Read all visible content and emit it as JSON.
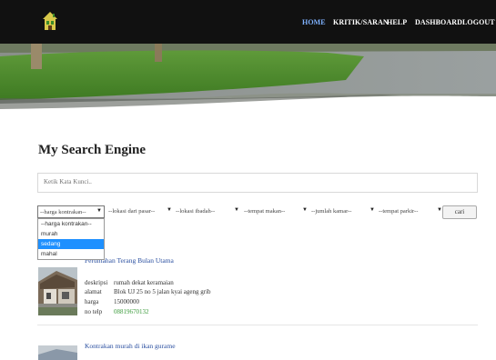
{
  "nav": {
    "items": [
      {
        "label": "HOME",
        "active": true
      },
      {
        "label": "KRITIK/SARAN",
        "active": false
      },
      {
        "label": "HELP",
        "active": false
      },
      {
        "label": "DASHBOARD",
        "active": false
      },
      {
        "label": "LOGOUT",
        "active": false
      }
    ]
  },
  "page": {
    "title": "My Search Engine",
    "search_placeholder": "Ketik Kata Kunci.."
  },
  "filters": [
    {
      "label": "--harga kontrakan--"
    },
    {
      "label": "--lokasi dari pasar--"
    },
    {
      "label": "--lokasi ibadah--"
    },
    {
      "label": "--tempat makan--"
    },
    {
      "label": "--jumlah kamar--"
    },
    {
      "label": "--tempat parkir--"
    }
  ],
  "price_dropdown": {
    "options": [
      "--harga kontrakan--",
      "murah",
      "sedang",
      "mahal"
    ],
    "highlighted": "sedang"
  },
  "search_button": "cari",
  "results": [
    {
      "title": "Perumahan Terang Bulan Utama",
      "fields": [
        {
          "label": "deskripsi",
          "value": "rumah dekat keramaian"
        },
        {
          "label": "alamat",
          "value": "Blok UJ 25 no 5 jalan kyai ageng grib"
        },
        {
          "label": "harga",
          "value": "15000000"
        },
        {
          "label": "no telp",
          "value": "08819670132"
        }
      ]
    },
    {
      "title": "Kontrakan murah di ikan gurame",
      "fields": []
    }
  ],
  "colors": {
    "topbar": "#111111",
    "nav_active": "#7fb2ff",
    "link": "#2a4fa0",
    "phone": "#3a9a3a",
    "highlight": "#1e90ff"
  },
  "icons": {
    "logo": "house-logo-icon",
    "dropdown_arrow": "caret-down-icon"
  }
}
